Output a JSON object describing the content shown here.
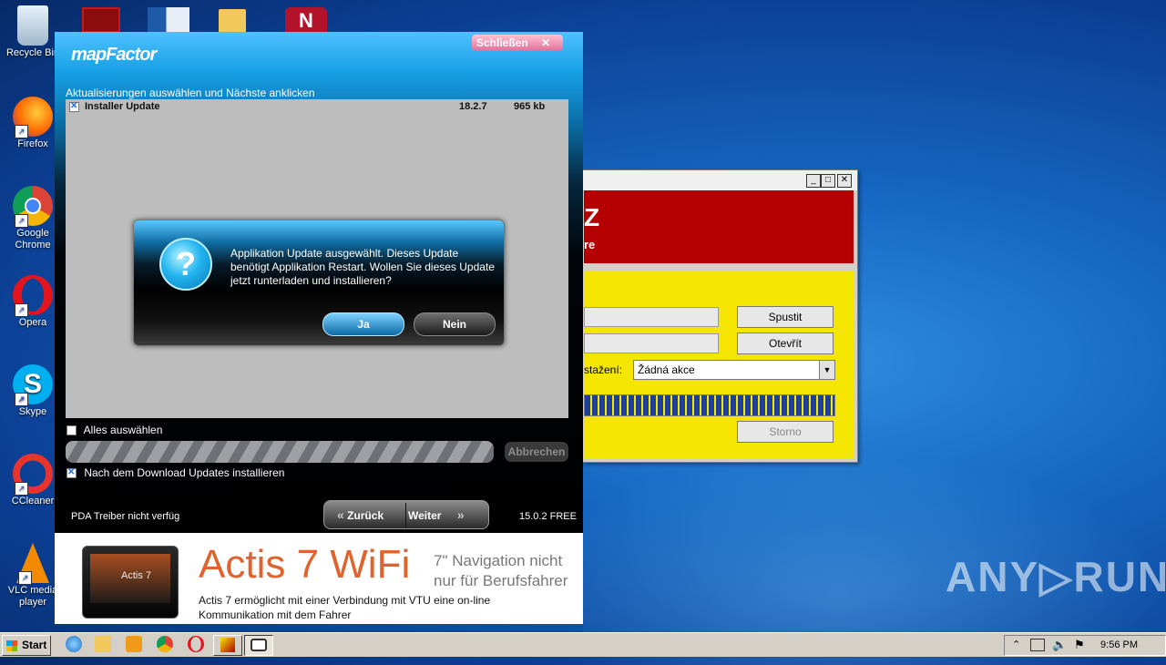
{
  "desktop": {
    "icons": [
      {
        "label": "Recycle Bin"
      },
      {
        "label": "Firefox"
      },
      {
        "label": "Google Chrome"
      },
      {
        "label": "Opera"
      },
      {
        "label": "Skype"
      },
      {
        "label": "CCleaner"
      },
      {
        "label": "VLC media player"
      }
    ],
    "watermark": "ANY▷RUN"
  },
  "background_window": {
    "title_red_big": "Z",
    "title_red_small": "re",
    "buttons": {
      "run": "Spustit",
      "open": "Otevřít",
      "cancel": "Storno"
    },
    "select_label": "stažení:",
    "select_value": "Žádná akce"
  },
  "mapfactor": {
    "logo": "mapFactor",
    "close_label": "Schließen",
    "instruction": "Aktualisierungen auswählen und Nächste anklicken",
    "updates": [
      {
        "name": "Installer Update",
        "version": "18.2.7",
        "size": "965 kb",
        "checked": true
      }
    ],
    "select_all": "Alles auswählen",
    "cancel_label": "Abbrechen",
    "install_after": "Nach dem Download Updates installieren",
    "pda_status": "PDA Treiber nicht verfüg",
    "back_label": "Zurück",
    "next_label": "Weiter",
    "version": "15.0.2 FREE",
    "dialog": {
      "message": "Applikation Update ausgewählt. Dieses Update benötigt Applikation Restart. Wollen Sie dieses Update jetzt runterladen und installieren?",
      "yes": "Ja",
      "no": "Nein"
    },
    "ad": {
      "title": "Actis 7  WiFi",
      "side": "7\" Navigation nicht nur für Berufsfahrer",
      "desc": "Actis 7 ermöglicht mit einer Verbindung mit VTU eine on-line Kommunikation mit dem Fahrer",
      "tablet_label": "Actis 7"
    }
  },
  "taskbar": {
    "start": "Start",
    "clock": "9:56 PM"
  }
}
